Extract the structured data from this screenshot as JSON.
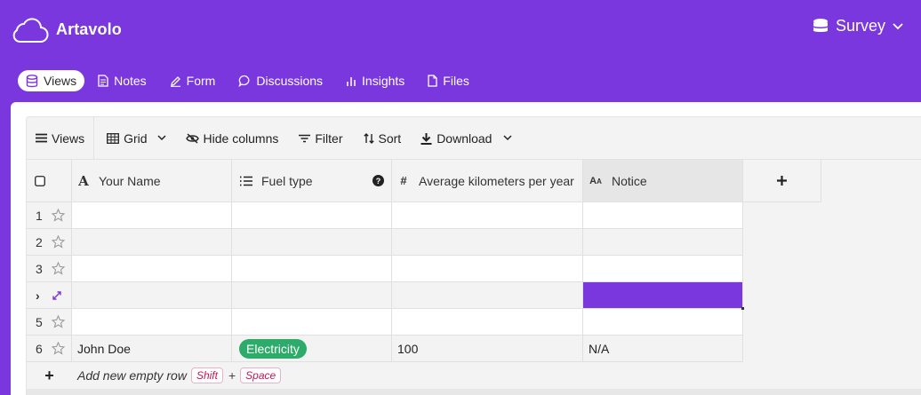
{
  "brand": {
    "name": "Artavolo"
  },
  "base": {
    "name": "Survey"
  },
  "tabs": [
    {
      "label": "Views",
      "icon": "database-icon",
      "active": true
    },
    {
      "label": "Notes",
      "icon": "document-icon"
    },
    {
      "label": "Form",
      "icon": "pencil-icon"
    },
    {
      "label": "Discussions",
      "icon": "speech-bubble-icon"
    },
    {
      "label": "Insights",
      "icon": "bar-chart-icon"
    },
    {
      "label": "Files",
      "icon": "file-icon"
    }
  ],
  "toolbar": {
    "views": "Views",
    "grid": "Grid",
    "hide_columns": "Hide columns",
    "filter": "Filter",
    "sort": "Sort",
    "download": "Download"
  },
  "columns": {
    "name": "Your Name",
    "fuel": "Fuel type",
    "avg": "Average kilometers per year",
    "notice": "Notice"
  },
  "rows": [
    {
      "index": "1",
      "name": "",
      "fuel": "",
      "avg": "",
      "notice": ""
    },
    {
      "index": "2",
      "name": "",
      "fuel": "",
      "avg": "",
      "notice": ""
    },
    {
      "index": "3",
      "name": "",
      "fuel": "",
      "avg": "",
      "notice": ""
    },
    {
      "index": "›",
      "name": "",
      "fuel": "",
      "avg": "",
      "notice": ""
    },
    {
      "index": "5",
      "name": "",
      "fuel": "",
      "avg": "",
      "notice": ""
    },
    {
      "index": "6",
      "name": "John Doe",
      "fuel": "Electricity",
      "avg": "100",
      "notice": "N/A"
    }
  ],
  "add_row": {
    "label": "Add new empty row",
    "key1": "Shift",
    "plus": "+",
    "key2": "Space"
  },
  "colors": {
    "accent": "#7a37dd",
    "tag_green": "#2cab6b"
  }
}
